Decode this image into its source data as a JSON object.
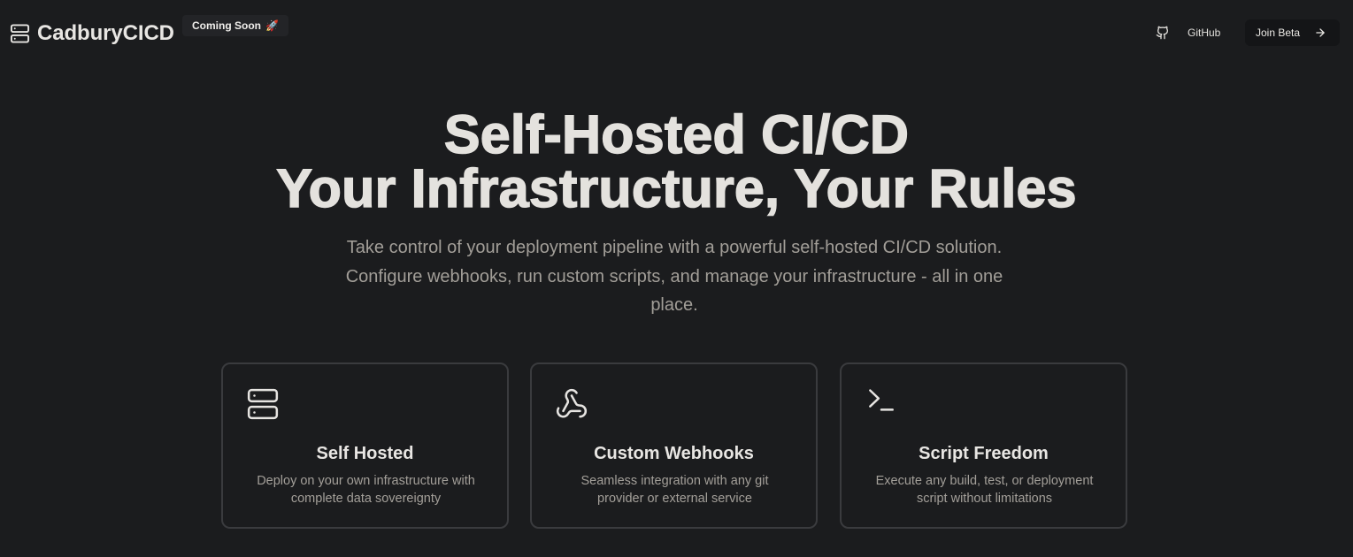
{
  "header": {
    "brand_name": "CadburyCICD",
    "brand_icon": "server-icon",
    "badge_label": "Coming Soon",
    "badge_emoji": "🚀",
    "github_label": "GitHub",
    "github_icon": "github-icon",
    "join_label": "Join Beta",
    "join_icon": "arrow-right-icon"
  },
  "hero": {
    "title_line1": "Self-Hosted CI/CD",
    "title_line2": "Your Infrastructure, Your Rules",
    "subtitle": "Take control of your deployment pipeline with a powerful self-hosted CI/CD solution. Configure webhooks, run custom scripts, and manage your infrastructure - all in one place."
  },
  "features": [
    {
      "icon": "server-icon",
      "title": "Self Hosted",
      "description": "Deploy on your own infrastructure with complete data sovereignty"
    },
    {
      "icon": "webhook-icon",
      "title": "Custom Webhooks",
      "description": "Seamless integration with any git provider or external service"
    },
    {
      "icon": "terminal-icon",
      "title": "Script Freedom",
      "description": "Execute any build, test, or deployment script without limitations"
    }
  ],
  "colors": {
    "background": "#1b1c1e",
    "text": "#e6e4e1",
    "muted_text": "#a29e98",
    "card_border": "#3a3b3e"
  }
}
